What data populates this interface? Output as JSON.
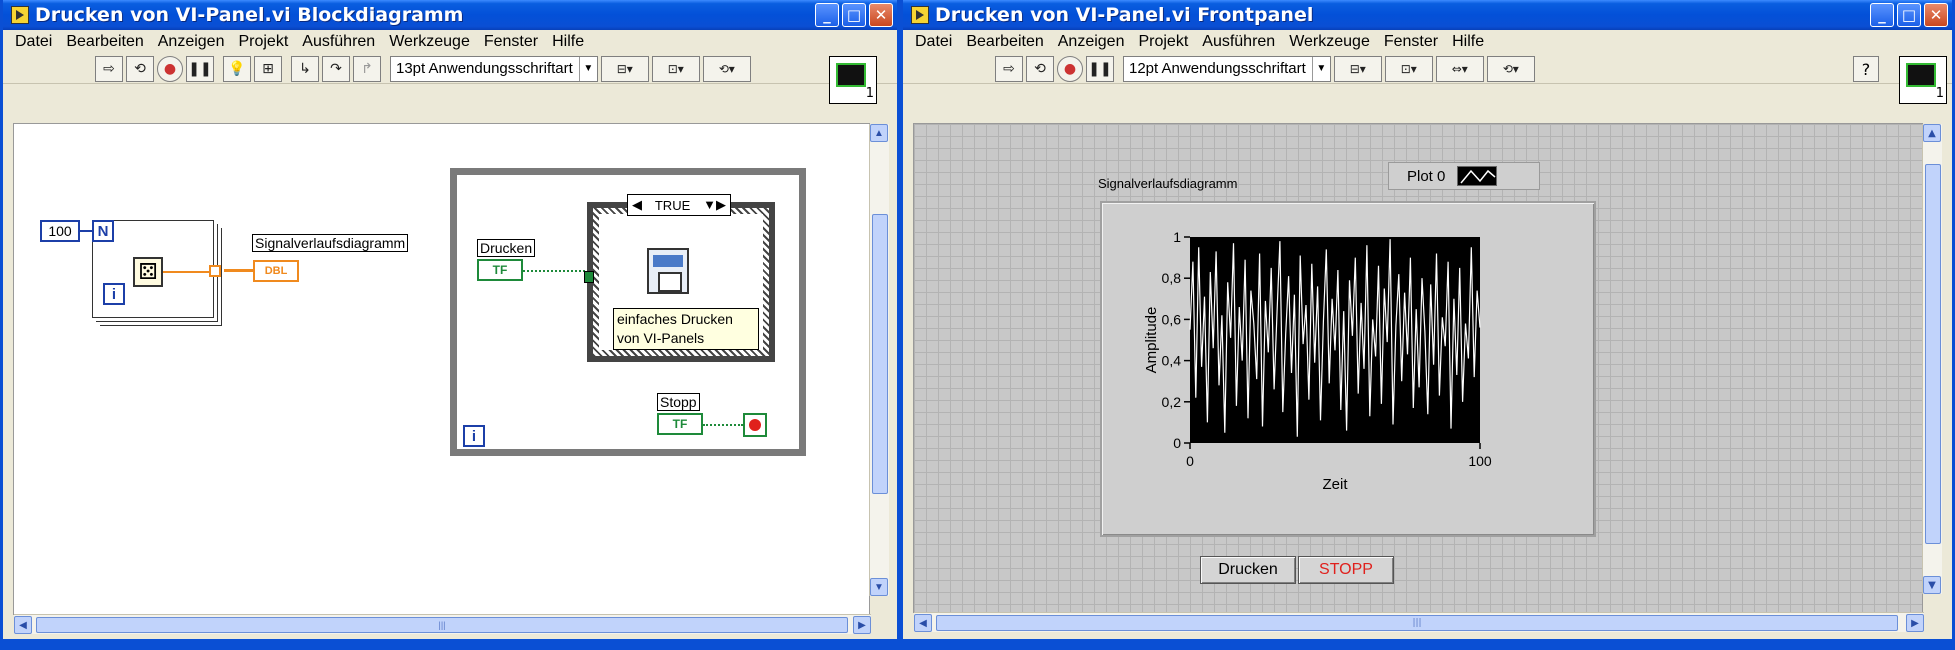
{
  "left_window": {
    "title": "Drucken von VI-Panel.vi Blockdiagramm",
    "menu": [
      "Datei",
      "Bearbeiten",
      "Anzeigen",
      "Projekt",
      "Ausführen",
      "Werkzeuge",
      "Fenster",
      "Hilfe"
    ],
    "font_select": "13pt Anwendungsschriftart",
    "icon_number": "1",
    "diagram": {
      "loop_count_constant": "100",
      "for_loop_count_terminal": "N",
      "for_loop_iteration_terminal": "i",
      "indicator_label": "Signalverlaufsdiagramm",
      "indicator_type": "DBL",
      "control_print_label": "Drucken",
      "control_print_type": "TF",
      "case_selector_value": "TRUE",
      "subvi_comment": "einfaches Drucken von VI-Panels",
      "stop_control_label": "Stopp",
      "stop_control_type": "TF",
      "while_loop_iteration_terminal": "i"
    }
  },
  "right_window": {
    "title": "Drucken von VI-Panel.vi Frontpanel",
    "menu": [
      "Datei",
      "Bearbeiten",
      "Anzeigen",
      "Projekt",
      "Ausführen",
      "Werkzeuge",
      "Fenster",
      "Hilfe"
    ],
    "font_select": "12pt Anwendungsschriftart",
    "help_label": "?",
    "icon_number": "1",
    "graph_label": "Signalverlaufsdiagramm",
    "legend_label": "Plot 0",
    "button_print": "Drucken",
    "button_stop": "STOPP",
    "stop_color": "#e0201c"
  },
  "chart_data": {
    "type": "line",
    "title": "",
    "xlabel": "Zeit",
    "ylabel": "Amplitude",
    "xlim": [
      0,
      100
    ],
    "ylim": [
      0,
      1
    ],
    "xticks": [
      "0",
      "100"
    ],
    "yticks": [
      "0",
      "0,2",
      "0,4",
      "0,6",
      "0,8",
      "1"
    ],
    "series": [
      {
        "name": "Plot 0",
        "color": "#ffffff",
        "values": [
          0.55,
          0.88,
          0.22,
          0.95,
          0.37,
          0.71,
          0.1,
          0.83,
          0.46,
          0.93,
          0.28,
          0.62,
          0.05,
          0.78,
          0.51,
          0.97,
          0.18,
          0.66,
          0.4,
          0.89,
          0.12,
          0.74,
          0.58,
          0.31,
          0.92,
          0.08,
          0.69,
          0.44,
          0.85,
          0.26,
          0.63,
          0.98,
          0.15,
          0.53,
          0.81,
          0.34,
          0.72,
          0.03,
          0.91,
          0.48,
          0.67,
          0.21,
          0.87,
          0.39,
          0.76,
          0.11,
          0.59,
          0.94,
          0.29,
          0.7,
          0.45,
          0.84,
          0.16,
          0.64,
          0.06,
          0.79,
          0.52,
          0.9,
          0.24,
          0.68,
          0.36,
          0.96,
          0.13,
          0.6,
          0.42,
          0.86,
          0.19,
          0.75,
          0.49,
          0.99,
          0.09,
          0.57,
          0.82,
          0.3,
          0.73,
          0.43,
          0.9,
          0.17,
          0.65,
          0.27,
          0.8,
          0.54,
          0.14,
          0.77,
          0.38,
          0.92,
          0.23,
          0.61,
          0.47,
          0.88,
          0.07,
          0.7,
          0.33,
          0.85,
          0.2,
          0.58,
          0.41,
          0.95,
          0.32,
          0.74,
          0.56
        ]
      }
    ]
  }
}
